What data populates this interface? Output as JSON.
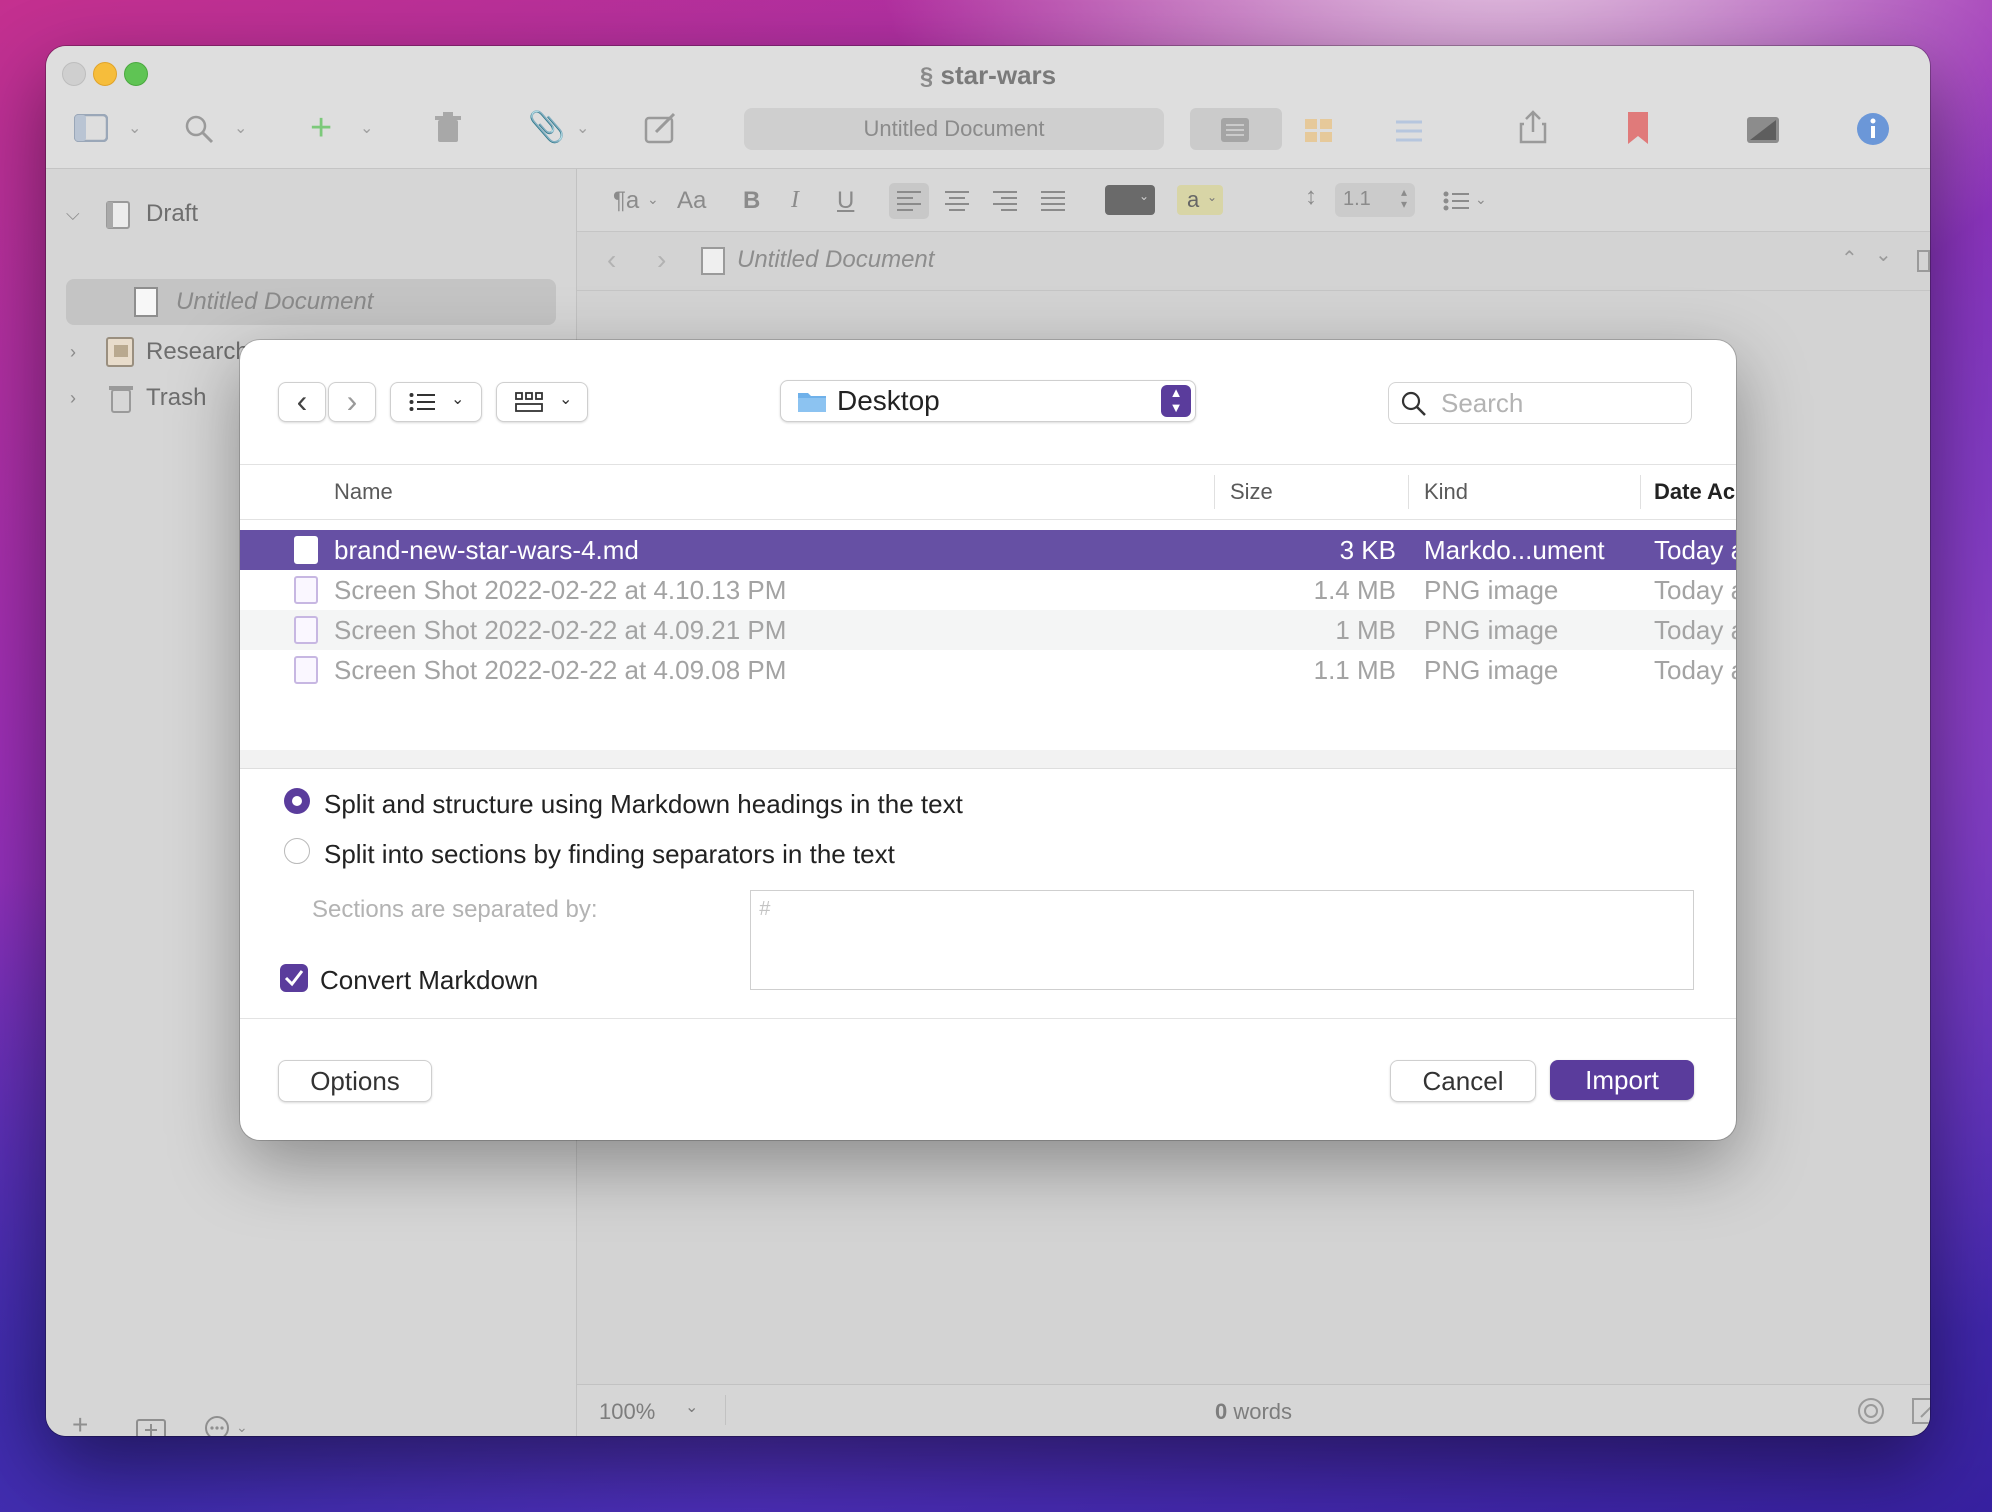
{
  "window": {
    "title": "star-wars",
    "toolbar": {
      "document_title": "Untitled Document"
    }
  },
  "format_bar": {
    "paragraph_style": "¶a",
    "font_label": "Aa",
    "bold": "B",
    "italic": "I",
    "underline": "U",
    "highlight_label": "a",
    "line_spacing": "1.1"
  },
  "sidebar": {
    "items": [
      {
        "label": "Draft"
      },
      {
        "label": "Untitled Document"
      },
      {
        "label": "Research"
      },
      {
        "label": "Trash"
      }
    ]
  },
  "editor": {
    "header_title": "Untitled Document",
    "zoom": "100%",
    "word_count": "0",
    "word_label": "words"
  },
  "dialog": {
    "location": "Desktop",
    "search_placeholder": "Search",
    "columns": {
      "name": "Name",
      "size": "Size",
      "kind": "Kind",
      "date": "Date Ac"
    },
    "files": [
      {
        "name": "brand-new-star-wars-4.md",
        "size": "3 KB",
        "kind": "Markdo...ument",
        "date": "Today a"
      },
      {
        "name": "Screen Shot 2022-02-22 at 4.10.13 PM",
        "size": "1.4 MB",
        "kind": "PNG image",
        "date": "Today a"
      },
      {
        "name": "Screen Shot 2022-02-22 at 4.09.21 PM",
        "size": "1 MB",
        "kind": "PNG image",
        "date": "Today a"
      },
      {
        "name": "Screen Shot 2022-02-22 at 4.09.08 PM",
        "size": "1.1 MB",
        "kind": "PNG image",
        "date": "Today a"
      }
    ],
    "options": {
      "split_headings": "Split and structure using Markdown headings in the text",
      "split_separators": "Split into sections by finding separators in the text",
      "separator_label": "Sections are separated by:",
      "separator_placeholder": "#",
      "convert_markdown": "Convert Markdown"
    },
    "buttons": {
      "options": "Options",
      "cancel": "Cancel",
      "import": "Import"
    }
  },
  "colors": {
    "accent": "#5a3c9c",
    "selection": "#6650a4"
  }
}
